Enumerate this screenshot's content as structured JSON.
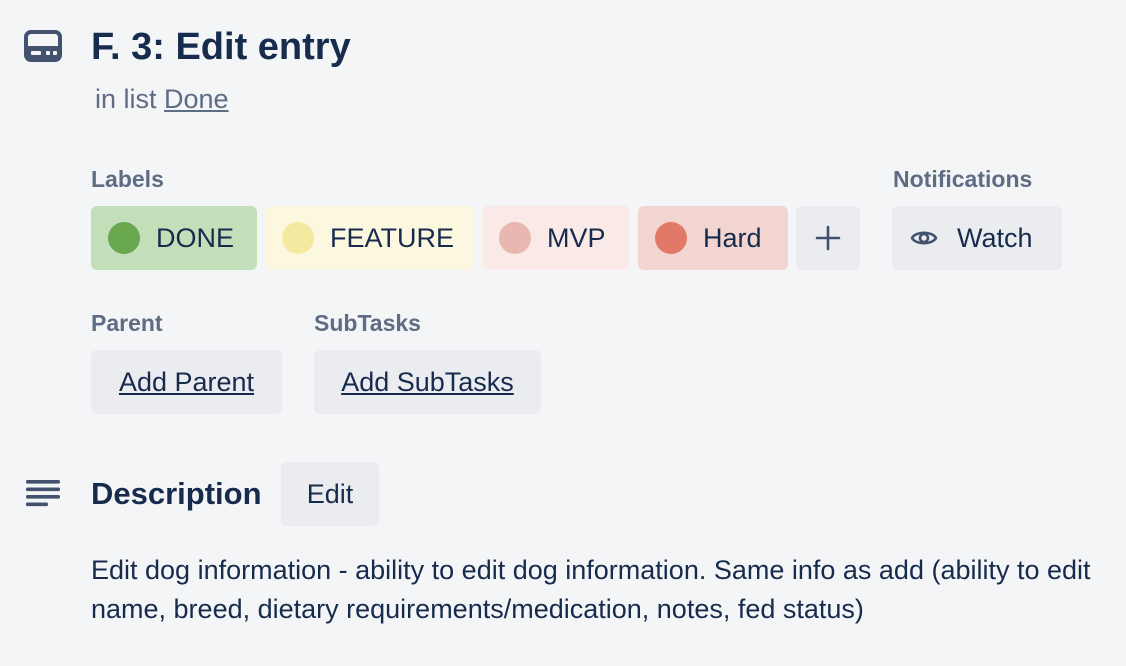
{
  "card": {
    "title": "F. 3: Edit entry",
    "in_list_prefix": "in list",
    "list_name": "Done"
  },
  "labels": {
    "heading": "Labels",
    "items": [
      {
        "text": "DONE",
        "bg": "#c2dfba",
        "dot": "#6aa84f"
      },
      {
        "text": "FEATURE",
        "bg": "#fcf7df",
        "dot": "#f5e99f"
      },
      {
        "text": "MVP",
        "bg": "#f9e9e7",
        "dot": "#e8b8b0"
      },
      {
        "text": "Hard",
        "bg": "#f2d5d0",
        "dot": "#e27868"
      }
    ],
    "add_icon": "plus-icon"
  },
  "notifications": {
    "heading": "Notifications",
    "watch_label": "Watch",
    "watch_icon": "eye-icon"
  },
  "parent": {
    "heading": "Parent",
    "button": "Add Parent"
  },
  "subtasks": {
    "heading": "SubTasks",
    "button": "Add SubTasks"
  },
  "description": {
    "heading": "Description",
    "edit_button": "Edit",
    "text": "Edit dog information - ability to edit dog information. Same info as add (ability to edit name, breed, dietary requirements/medication, notes, fed status)",
    "icon": "description-lines-icon"
  },
  "colors": {
    "background": "#f4f5f7",
    "button_bg": "#ebecf0",
    "text_primary": "#172b4d",
    "text_secondary": "#5e6c84"
  }
}
